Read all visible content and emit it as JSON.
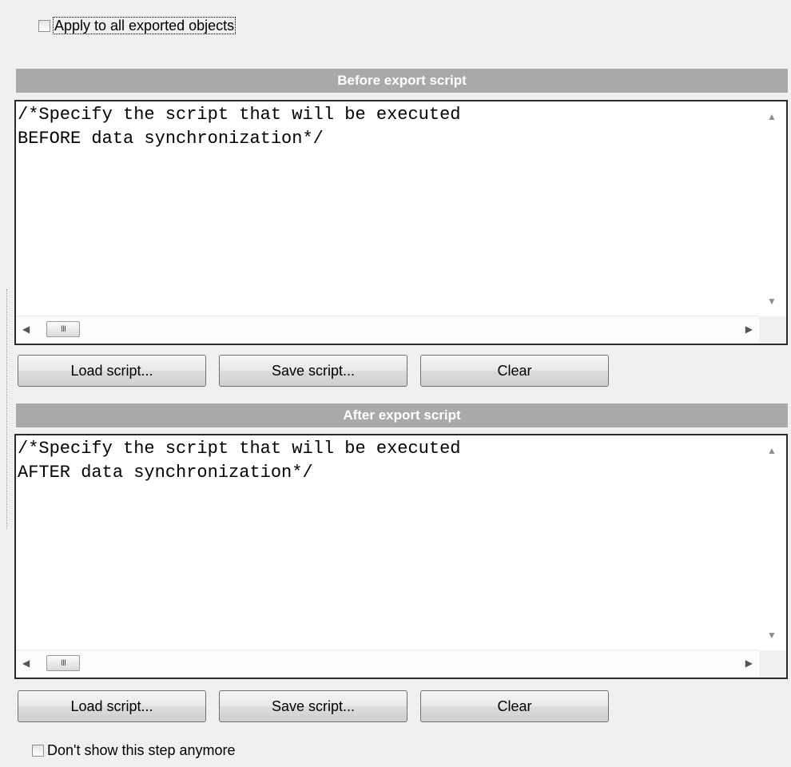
{
  "apply_all": {
    "label": "Apply to all exported objects",
    "checked": false
  },
  "before": {
    "header": "Before export script",
    "script": "/*Specify the script that will be executed\nBEFORE data synchronization*/"
  },
  "after": {
    "header": "After export script",
    "script": "/*Specify the script that will be executed\nAFTER data synchronization*/"
  },
  "buttons": {
    "load": "Load script...",
    "save": "Save script...",
    "clear": "Clear"
  },
  "scrollbar": {
    "thumb_grip": "III"
  },
  "dont_show": {
    "label": "Don't show this step anymore",
    "checked": false
  }
}
